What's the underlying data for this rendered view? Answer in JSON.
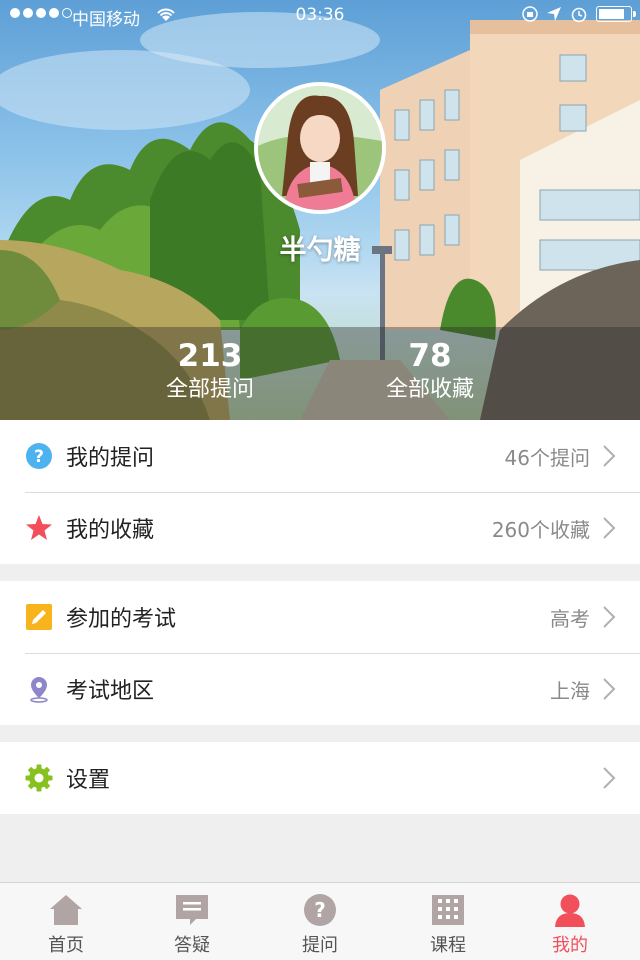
{
  "status_bar": {
    "carrier": "中国移动",
    "time": "03:36",
    "battery_level": 0.9
  },
  "profile": {
    "name": "半勺糖",
    "stats": [
      {
        "value": "213",
        "label": "全部提问"
      },
      {
        "value": "78",
        "label": "全部收藏"
      }
    ]
  },
  "menu": {
    "my_questions": {
      "label": "我的提问",
      "value": "46个提问",
      "icon": "question-circle-icon",
      "color": "#4db3f0"
    },
    "my_favorites": {
      "label": "我的收藏",
      "value": "260个收藏",
      "icon": "star-icon",
      "color": "#f1505b"
    },
    "exam": {
      "label": "参加的考试",
      "value": "高考",
      "icon": "pencil-icon",
      "color": "#f7b41c"
    },
    "region": {
      "label": "考试地区",
      "value": "上海",
      "icon": "location-pin-icon",
      "color": "#8d86c9"
    },
    "settings": {
      "label": "设置",
      "value": "",
      "icon": "gear-icon",
      "color": "#86c11f"
    }
  },
  "tabbar": {
    "active_color": "#f1505b",
    "inactive_color": "#b0a4a4",
    "tabs": [
      {
        "label": "首页",
        "icon": "home-icon"
      },
      {
        "label": "答疑",
        "icon": "message-icon"
      },
      {
        "label": "提问",
        "icon": "question-icon"
      },
      {
        "label": "课程",
        "icon": "calendar-icon"
      },
      {
        "label": "我的",
        "icon": "person-icon",
        "active": true
      }
    ]
  }
}
